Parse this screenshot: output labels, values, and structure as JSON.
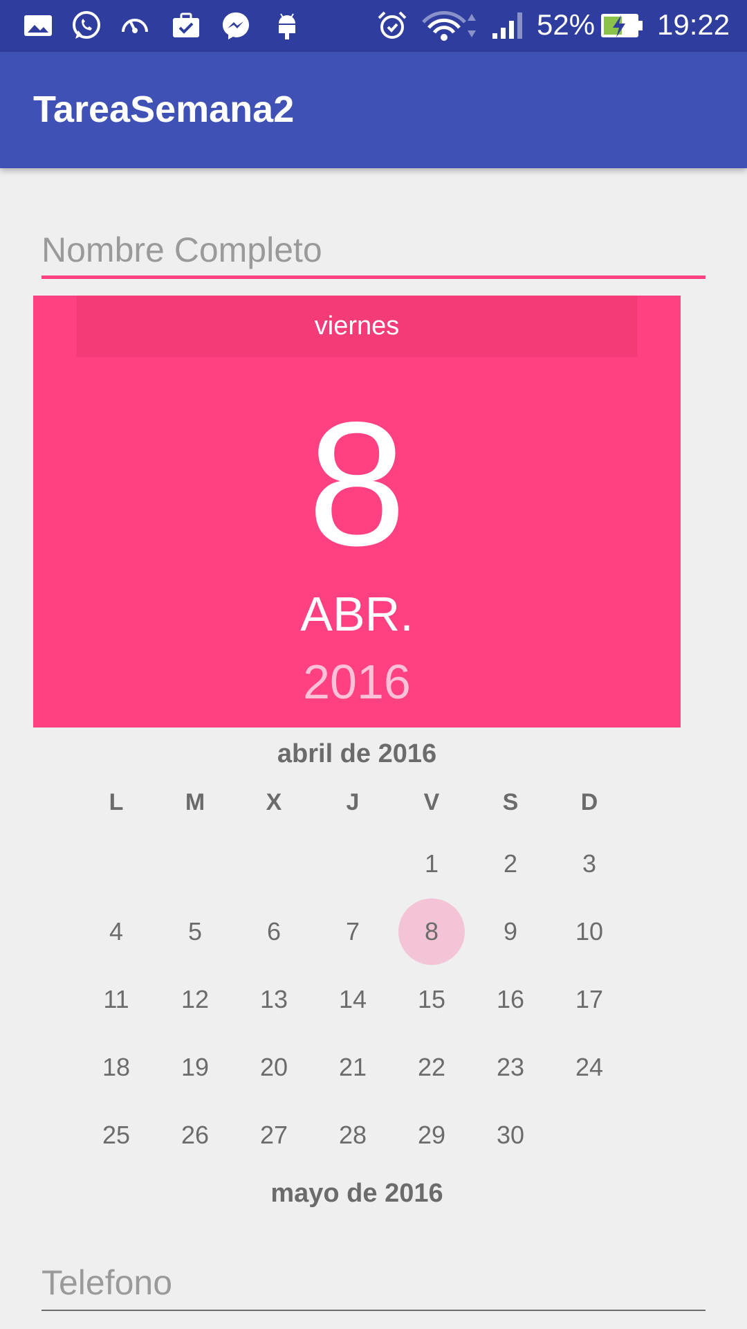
{
  "status_bar": {
    "battery_percent": "52%",
    "time": "19:22",
    "icons": [
      "gallery-icon",
      "whatsapp-icon",
      "speedometer-icon",
      "briefcase-icon",
      "messenger-icon",
      "android-icon",
      "alarm-icon",
      "wifi-icon",
      "signal-icon",
      "battery-charging-icon"
    ]
  },
  "app_bar": {
    "title": "TareaSemana2"
  },
  "form": {
    "name_field": {
      "placeholder": "Nombre Completo"
    },
    "phone_field": {
      "placeholder": "Telefono"
    }
  },
  "date_picker": {
    "weekday": "viernes",
    "day": "8",
    "month_abbr": "ABR.",
    "year": "2016",
    "current_month_title": "abril de 2016",
    "next_month_title": "mayo de 2016",
    "weekday_headers": [
      "L",
      "M",
      "X",
      "J",
      "V",
      "S",
      "D"
    ],
    "weeks": [
      [
        "",
        "",
        "",
        "",
        "1",
        "2",
        "3"
      ],
      [
        "4",
        "5",
        "6",
        "7",
        "8",
        "9",
        "10"
      ],
      [
        "11",
        "12",
        "13",
        "14",
        "15",
        "16",
        "17"
      ],
      [
        "18",
        "19",
        "20",
        "21",
        "22",
        "23",
        "24"
      ],
      [
        "25",
        "26",
        "27",
        "28",
        "29",
        "30",
        ""
      ]
    ],
    "selected_day": "8"
  },
  "colors": {
    "status_bar": "#2f3e9e",
    "app_bar": "#3f51b5",
    "accent": "#ff4081",
    "selected_day_bg": "#f3c4d5"
  }
}
